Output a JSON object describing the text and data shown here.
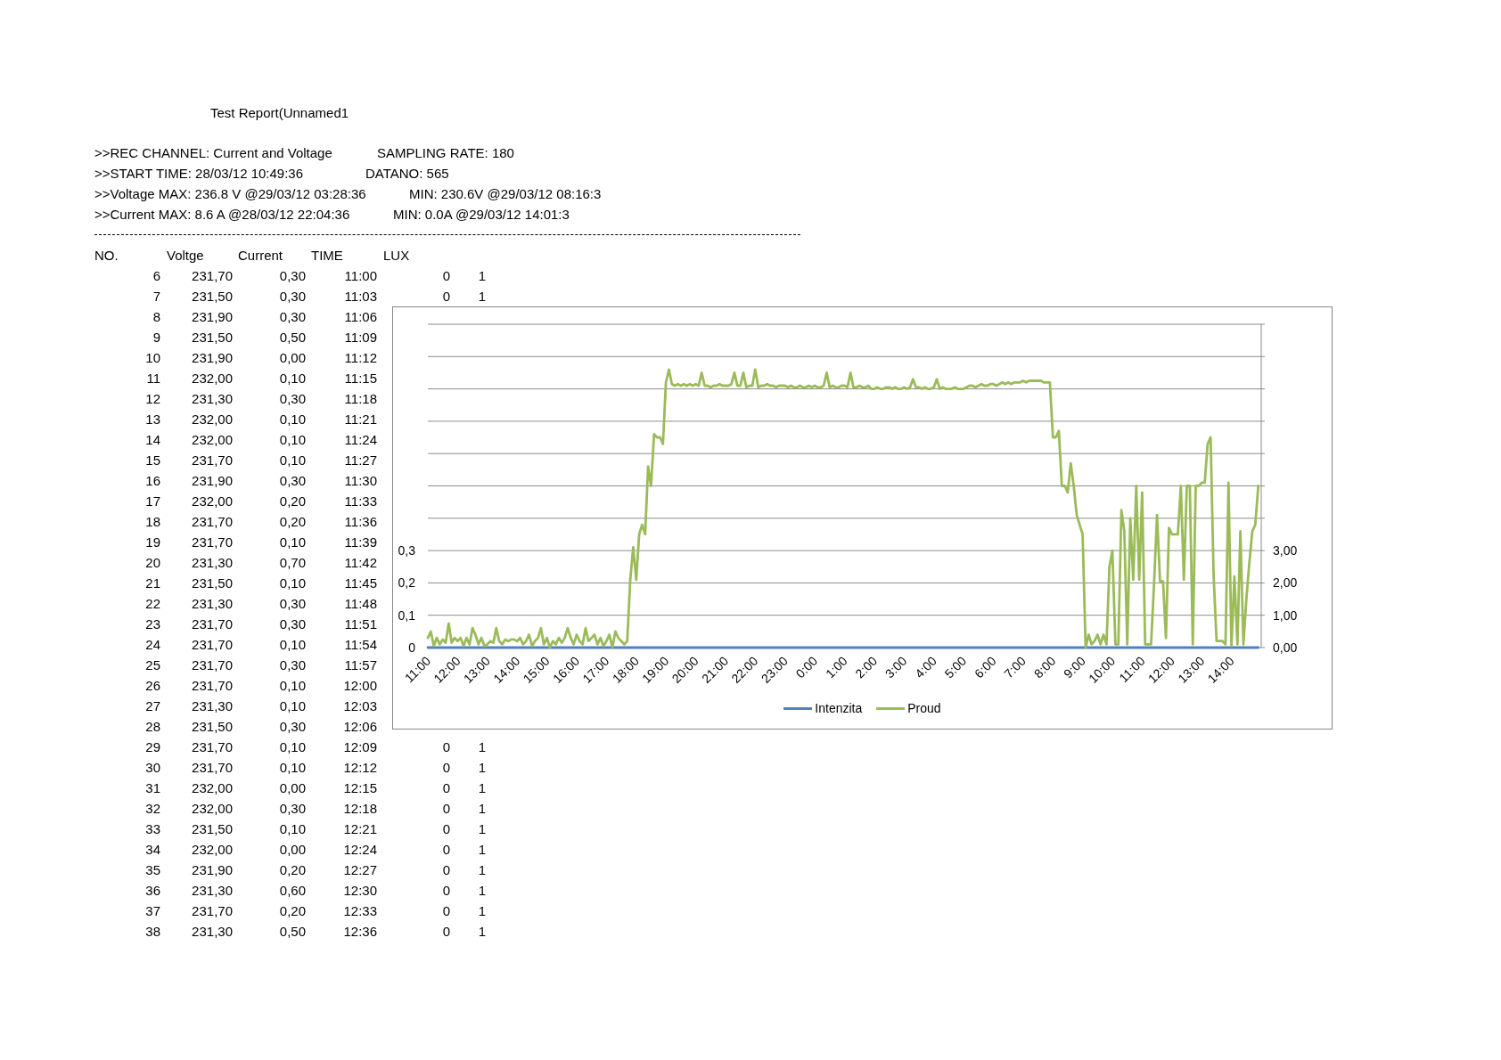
{
  "report": {
    "title": "Test Report(Unnamed1",
    "info_lines": [
      {
        "left": ">>REC CHANNEL: Current and Voltage",
        "right": "SAMPLING RATE: 180"
      },
      {
        "left": ">>START TIME: 28/03/12 10:49:36",
        "right": "DATANO: 565"
      },
      {
        "left": ">>Voltage MAX: 236.8 V @29/03/12 03:28:36",
        "right": "MIN: 230.6V @29/03/12 08:16:3"
      },
      {
        "left": ">>Current MAX: 8.6 A @28/03/12 22:04:36",
        "right": "MIN: 0.0A @29/03/12 14:01:3"
      }
    ]
  },
  "table": {
    "columns": [
      "NO.",
      "Voltge",
      "Current",
      "TIME",
      "LUX"
    ],
    "rows": [
      [
        "6",
        "231,70",
        "0,30",
        "11:00",
        "0",
        "1"
      ],
      [
        "7",
        "231,50",
        "0,30",
        "11:03",
        "0",
        "1"
      ],
      [
        "8",
        "231,90",
        "0,30",
        "11:06"
      ],
      [
        "9",
        "231,50",
        "0,50",
        "11:09"
      ],
      [
        "10",
        "231,90",
        "0,00",
        "11:12"
      ],
      [
        "11",
        "232,00",
        "0,10",
        "11:15"
      ],
      [
        "12",
        "231,30",
        "0,30",
        "11:18"
      ],
      [
        "13",
        "232,00",
        "0,10",
        "11:21"
      ],
      [
        "14",
        "232,00",
        "0,10",
        "11:24"
      ],
      [
        "15",
        "231,70",
        "0,10",
        "11:27"
      ],
      [
        "16",
        "231,90",
        "0,30",
        "11:30"
      ],
      [
        "17",
        "232,00",
        "0,20",
        "11:33"
      ],
      [
        "18",
        "231,70",
        "0,20",
        "11:36"
      ],
      [
        "19",
        "231,70",
        "0,10",
        "11:39"
      ],
      [
        "20",
        "231,30",
        "0,70",
        "11:42"
      ],
      [
        "21",
        "231,50",
        "0,10",
        "11:45"
      ],
      [
        "22",
        "231,30",
        "0,30",
        "11:48"
      ],
      [
        "23",
        "231,70",
        "0,30",
        "11:51"
      ],
      [
        "24",
        "231,70",
        "0,10",
        "11:54"
      ],
      [
        "25",
        "231,70",
        "0,30",
        "11:57"
      ],
      [
        "26",
        "231,70",
        "0,10",
        "12:00"
      ],
      [
        "27",
        "231,30",
        "0,10",
        "12:03"
      ],
      [
        "28",
        "231,50",
        "0,30",
        "12:06"
      ],
      [
        "29",
        "231,70",
        "0,10",
        "12:09",
        "0",
        "1"
      ],
      [
        "30",
        "231,70",
        "0,10",
        "12:12",
        "0",
        "1"
      ],
      [
        "31",
        "232,00",
        "0,00",
        "12:15",
        "0",
        "1"
      ],
      [
        "32",
        "232,00",
        "0,30",
        "12:18",
        "0",
        "1"
      ],
      [
        "33",
        "231,50",
        "0,10",
        "12:21",
        "0",
        "1"
      ],
      [
        "34",
        "232,00",
        "0,00",
        "12:24",
        "0",
        "1"
      ],
      [
        "35",
        "231,90",
        "0,20",
        "12:27",
        "0",
        "1"
      ],
      [
        "36",
        "231,30",
        "0,60",
        "12:30",
        "0",
        "1"
      ],
      [
        "37",
        "231,70",
        "0,20",
        "12:33",
        "0",
        "1"
      ],
      [
        "38",
        "231,30",
        "0,50",
        "12:36",
        "0",
        "1"
      ]
    ]
  },
  "chart": {
    "chart_data": {
      "type": "line",
      "grid": "y",
      "legend": "bottom",
      "ylim": [
        0,
        1
      ],
      "y2lim": [
        0,
        10
      ],
      "yticks": [
        {
          "value": 0,
          "label": "0"
        },
        {
          "value": 0.1,
          "label": "0,1"
        },
        {
          "value": 0.2,
          "label": "0,2"
        },
        {
          "value": 0.3,
          "label": "0,3"
        }
      ],
      "y2ticks": [
        {
          "value": 0,
          "label": "0,00"
        },
        {
          "value": 1,
          "label": "1,00"
        },
        {
          "value": 2,
          "label": "2,00"
        },
        {
          "value": 3,
          "label": "3,00"
        }
      ],
      "categories": [
        "11:00",
        null,
        null,
        null,
        null,
        null,
        null,
        null,
        null,
        null,
        "12:00",
        null,
        null,
        null,
        null,
        null,
        null,
        null,
        null,
        null,
        "13:00",
        null,
        null,
        null,
        null,
        null,
        null,
        null,
        null,
        null,
        "14:00",
        null,
        null,
        null,
        null,
        null,
        null,
        null,
        null,
        null,
        "15:00",
        null,
        null,
        null,
        null,
        null,
        null,
        null,
        null,
        null,
        "16:00",
        null,
        null,
        null,
        null,
        null,
        null,
        null,
        null,
        null,
        "17:00",
        null,
        null,
        null,
        null,
        null,
        null,
        null,
        null,
        null,
        "18:00",
        null,
        null,
        null,
        null,
        null,
        null,
        null,
        null,
        null,
        "19:00",
        null,
        null,
        null,
        null,
        null,
        null,
        null,
        null,
        null,
        "20:00",
        null,
        null,
        null,
        null,
        null,
        null,
        null,
        null,
        null,
        "21:00",
        null,
        null,
        null,
        null,
        null,
        null,
        null,
        null,
        null,
        "22:00",
        null,
        null,
        null,
        null,
        null,
        null,
        null,
        null,
        null,
        "23:00",
        null,
        null,
        null,
        null,
        null,
        null,
        null,
        null,
        null,
        "0:00",
        null,
        null,
        null,
        null,
        null,
        null,
        null,
        null,
        null,
        "1:00",
        null,
        null,
        null,
        null,
        null,
        null,
        null,
        null,
        null,
        "2:00",
        null,
        null,
        null,
        null,
        null,
        null,
        null,
        null,
        null,
        "3:00",
        null,
        null,
        null,
        null,
        null,
        null,
        null,
        null,
        null,
        "4:00",
        null,
        null,
        null,
        null,
        null,
        null,
        null,
        null,
        null,
        "5:00",
        null,
        null,
        null,
        null,
        null,
        null,
        null,
        null,
        null,
        "6:00",
        null,
        null,
        null,
        null,
        null,
        null,
        null,
        null,
        null,
        "7:00",
        null,
        null,
        null,
        null,
        null,
        null,
        null,
        null,
        null,
        "8:00",
        null,
        null,
        null,
        null,
        null,
        null,
        null,
        null,
        null,
        "9:00",
        null,
        null,
        null,
        null,
        null,
        null,
        null,
        null,
        null,
        "10:00",
        null,
        null,
        null,
        null,
        null,
        null,
        null,
        null,
        null,
        "11:00",
        null,
        null,
        null,
        null,
        null,
        null,
        null,
        null,
        null,
        "12:00",
        null,
        null,
        null,
        null,
        null,
        null,
        null,
        null,
        null,
        "13:00",
        null,
        null,
        null,
        null,
        null,
        null,
        null,
        null,
        null,
        "14:00",
        null,
        null,
        null,
        null,
        null,
        null,
        null,
        null,
        null
      ],
      "series": [
        {
          "name": "Intenzita",
          "color": "#4f81bd",
          "values": [
            0,
            0,
            0,
            0,
            0,
            0,
            0,
            0,
            0,
            0,
            0,
            0,
            0,
            0,
            0,
            0,
            0,
            0,
            0,
            0,
            0,
            0,
            0,
            0,
            0,
            0,
            0,
            0,
            0,
            0,
            0,
            0,
            0,
            0,
            0,
            0,
            0,
            0,
            0,
            0,
            0,
            0,
            0,
            0,
            0,
            0,
            0,
            0,
            0,
            0,
            0,
            0,
            0,
            0,
            0,
            0,
            0,
            0,
            0,
            0,
            0,
            0,
            0,
            0,
            0,
            0,
            0,
            0,
            0,
            0,
            0,
            0,
            0,
            0,
            0,
            0,
            0,
            0,
            0,
            0,
            0,
            0,
            0,
            0,
            0,
            0,
            0,
            0,
            0,
            0,
            0,
            0,
            0,
            0,
            0,
            0,
            0,
            0,
            0,
            0,
            0,
            0,
            0,
            0,
            0,
            0,
            0,
            0,
            0,
            0,
            0,
            0,
            0,
            0,
            0,
            0,
            0,
            0,
            0,
            0,
            0,
            0,
            0,
            0,
            0,
            0,
            0,
            0,
            0,
            0,
            0,
            0,
            0,
            0,
            0,
            0,
            0,
            0,
            0,
            0,
            0,
            0,
            0,
            0,
            0,
            0,
            0,
            0,
            0,
            0,
            0,
            0,
            0,
            0,
            0,
            0,
            0,
            0,
            0,
            0,
            0,
            0,
            0,
            0,
            0,
            0,
            0,
            0,
            0,
            0,
            0,
            0,
            0,
            0,
            0,
            0,
            0,
            0,
            0,
            0,
            0,
            0,
            0,
            0,
            0,
            0,
            0,
            0,
            0,
            0,
            0,
            0,
            0,
            0,
            0,
            0,
            0,
            0,
            0,
            0,
            0,
            0,
            0,
            0,
            0,
            0,
            0,
            0,
            0,
            0,
            0,
            0,
            0,
            0,
            0,
            0,
            0,
            0,
            0,
            0,
            0,
            0,
            0,
            0,
            0,
            0,
            0,
            0,
            0,
            0,
            0,
            0,
            0,
            0,
            0,
            0,
            0,
            0,
            0,
            0,
            0,
            0,
            0,
            0,
            0,
            0,
            0,
            0,
            0,
            0,
            0,
            0,
            0,
            0,
            0,
            0,
            0,
            0,
            0,
            0,
            0,
            0,
            0,
            0,
            0,
            0,
            0,
            0,
            0,
            0,
            0,
            0,
            0,
            0,
            0,
            0,
            0,
            0,
            0,
            0
          ]
        },
        {
          "name": "Proud",
          "color": "#9bbb59",
          "axis": "y2",
          "values": [
            0.3,
            0.5,
            0.05,
            0.3,
            0.1,
            0.25,
            0.15,
            0.75,
            0.15,
            0.3,
            0.2,
            0.3,
            0.05,
            0.3,
            0.1,
            0.6,
            0.4,
            0.1,
            0.3,
            0.05,
            0.1,
            0.2,
            0.15,
            0.6,
            0.2,
            0.1,
            0.25,
            0.2,
            0.25,
            0.25,
            0.2,
            0.3,
            0.1,
            0.2,
            0.4,
            0.05,
            0.2,
            0.3,
            0.6,
            0.1,
            0.3,
            0,
            0.2,
            0.1,
            0.3,
            0.15,
            0.3,
            0.6,
            0.3,
            0.1,
            0.4,
            0.2,
            0.1,
            0.6,
            0.2,
            0.3,
            0.4,
            0.1,
            0.3,
            0.05,
            0.2,
            0.4,
            0,
            0.5,
            0.3,
            0.2,
            0.1,
            0.2,
            2.1,
            3.1,
            2.1,
            3.5,
            3.8,
            3.5,
            5.6,
            5,
            6.6,
            6.5,
            6.5,
            6.3,
            8.2,
            8.6,
            8.15,
            8.1,
            8.15,
            8.1,
            8.15,
            8.1,
            8.15,
            8.1,
            8.15,
            8.1,
            8.5,
            8.1,
            8.1,
            8.05,
            8.1,
            8.1,
            8.15,
            8.1,
            8.1,
            8.1,
            8.15,
            8.5,
            8.1,
            8.1,
            8.5,
            8.05,
            8.1,
            8.1,
            8.6,
            8.05,
            8.1,
            8.1,
            8.15,
            8.1,
            8.1,
            8.05,
            8.1,
            8.1,
            8.1,
            8.05,
            8.1,
            8.05,
            8.05,
            8.1,
            8.05,
            8.05,
            8.1,
            8.05,
            8.1,
            8.05,
            8.05,
            8.1,
            8.5,
            8.05,
            8.1,
            8.05,
            8.05,
            8.1,
            8.1,
            8.05,
            8.5,
            8.05,
            8.05,
            8.1,
            8.05,
            8.05,
            8.1,
            8,
            8,
            8.05,
            8,
            8,
            8.05,
            8.05,
            8,
            8.05,
            8,
            8,
            8.05,
            8,
            8.05,
            8.3,
            8.05,
            8.05,
            8,
            8.05,
            8,
            8,
            8.05,
            8.3,
            8,
            8.05,
            8,
            8,
            8,
            8.05,
            8,
            8,
            8,
            8.05,
            8.1,
            8.1,
            8.05,
            8.1,
            8.15,
            8.1,
            8.1,
            8.15,
            8.15,
            8.1,
            8.15,
            8.2,
            8.15,
            8.2,
            8.15,
            8.2,
            8.2,
            8.2,
            8.25,
            8.2,
            8.25,
            8.25,
            8.25,
            8.25,
            8.25,
            8.2,
            8.2,
            8.2,
            6.5,
            6.5,
            6.7,
            5,
            5,
            4.8,
            5.7,
            5,
            4.1,
            3.8,
            3.5,
            0,
            0.4,
            0.1,
            0.2,
            0.4,
            0.1,
            0.4,
            0.1,
            2.5,
            3,
            0.1,
            0.1,
            4.25,
            3.6,
            0.1,
            4,
            2.1,
            5,
            2.1,
            4.8,
            0.1,
            0.1,
            0.1,
            2,
            4.1,
            2.05,
            2.05,
            0.3,
            3.7,
            3.5,
            3.5,
            3.5,
            5,
            2.1,
            5,
            5,
            0.1,
            5,
            5,
            5.1,
            5.1,
            6.3,
            6.5,
            2.2,
            0.2,
            0.2,
            0.2,
            0.1,
            5.1,
            0.05,
            2.2,
            0.1,
            3.6,
            0.1,
            1.5,
            2.6,
            3.6,
            3.8,
            5
          ]
        }
      ]
    }
  }
}
